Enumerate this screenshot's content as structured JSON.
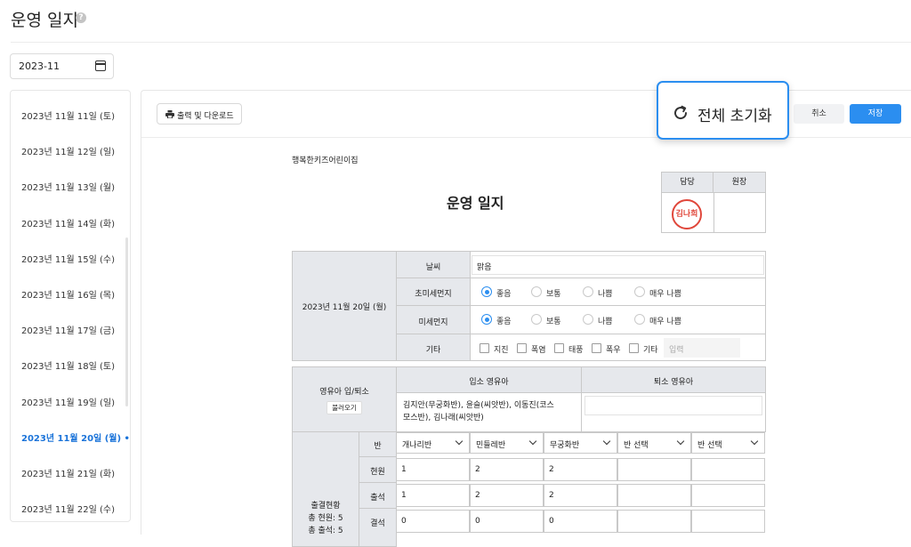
{
  "page": {
    "title": "운영 일지",
    "help_icon": "?"
  },
  "month_picker": {
    "value": "2023-11",
    "icon": "calendar-icon"
  },
  "date_list": [
    {
      "label": "2023년 11월 11일 (토)",
      "selected": false
    },
    {
      "label": "2023년 11월 12일 (일)",
      "selected": false
    },
    {
      "label": "2023년 11월 13일 (월)",
      "selected": false
    },
    {
      "label": "2023년 11월 14일 (화)",
      "selected": false
    },
    {
      "label": "2023년 11월 15일 (수)",
      "selected": false
    },
    {
      "label": "2023년 11월 16일 (목)",
      "selected": false
    },
    {
      "label": "2023년 11월 17일 (금)",
      "selected": false
    },
    {
      "label": "2023년 11월 18일 (토)",
      "selected": false
    },
    {
      "label": "2023년 11월 19일 (일)",
      "selected": false
    },
    {
      "label": "2023년 11월 20일 (월) •",
      "selected": true
    },
    {
      "label": "2023년 11월 21일 (화)",
      "selected": false
    },
    {
      "label": "2023년 11월 22일 (수)",
      "selected": false
    }
  ],
  "toolbar": {
    "print_label": "출력 및 다운로드",
    "reset_label": "전체 초기화",
    "cancel_label": "취소",
    "save_label": "저장",
    "accent": "#2b8ef0"
  },
  "doc": {
    "org": "행복한키즈어린이집",
    "title": "운영 일지",
    "sign": {
      "col1": "담당",
      "col2": "원장",
      "stamp": "김나희"
    },
    "date_label": "2023년 11월 20일 (월)",
    "weather": {
      "label": "날씨",
      "value": "맑음"
    },
    "ultra_fine_dust": {
      "label": "초미세먼지",
      "options": [
        "좋음",
        "보통",
        "나쁨",
        "매우 나쁨"
      ],
      "selected": "좋음"
    },
    "fine_dust": {
      "label": "미세먼지",
      "options": [
        "좋음",
        "보통",
        "나쁨",
        "매우 나쁨"
      ],
      "selected": "좋음"
    },
    "etc": {
      "label": "기타",
      "options": [
        "지진",
        "폭염",
        "태풍",
        "폭우",
        "기타"
      ],
      "placeholder": "입력"
    },
    "inout": {
      "label": "영유아 입/퇴소",
      "load_label": "불러오기",
      "in_header": "입소 영유아",
      "out_header": "퇴소 영유아",
      "in_value_line1": "김지안(무궁화반), 윤슬(씨앗반), 이동진(코스",
      "in_value_line2": "모스반), 김나래(씨앗반)",
      "out_value": ""
    },
    "attendance": {
      "label": "출결현황",
      "total_current": "총 현원: 5",
      "total_attend": "총 출석: 5",
      "class_label": "반",
      "current_label": "현원",
      "attend_label": "출석",
      "absent_label": "결석",
      "classes": [
        "개나리반",
        "민들레반",
        "무궁화반",
        "반 선택",
        "반 선택"
      ],
      "current": [
        "1",
        "2",
        "2",
        "",
        ""
      ],
      "attend": [
        "1",
        "2",
        "2",
        "",
        ""
      ],
      "absent": [
        "0",
        "0",
        "0",
        "",
        ""
      ]
    }
  }
}
